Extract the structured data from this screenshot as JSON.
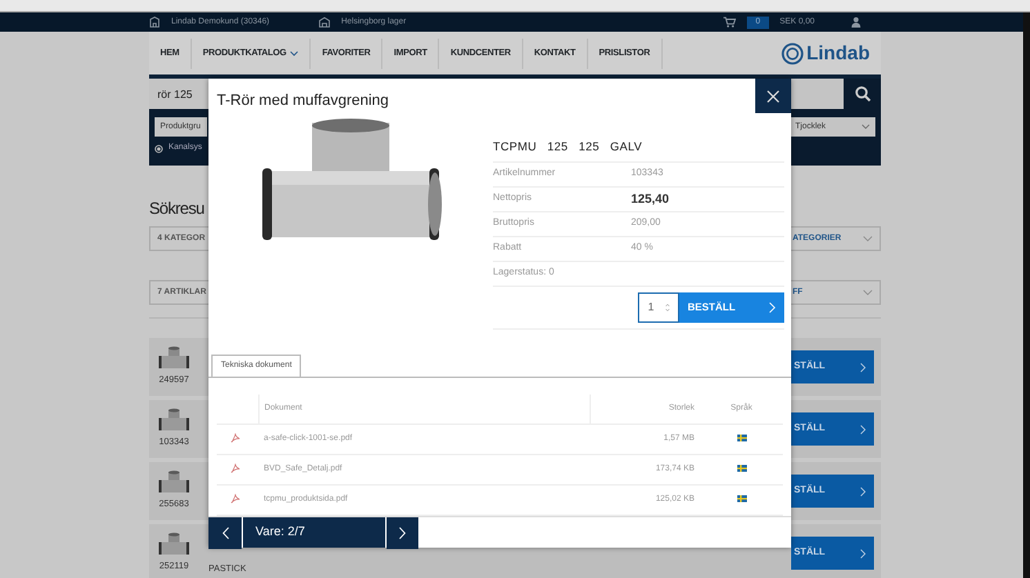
{
  "topbar": {
    "customer": "Lindab Demokund (30346)",
    "warehouse": "Helsingborg lager",
    "cart_count": "0",
    "cart_total": "SEK 0,00"
  },
  "nav": {
    "items": [
      {
        "label": "HEM",
        "dropdown": false
      },
      {
        "label": "PRODUKTKATALOG",
        "dropdown": true
      },
      {
        "label": "FAVORITER",
        "dropdown": false
      },
      {
        "label": "IMPORT",
        "dropdown": false
      },
      {
        "label": "KUNDCENTER",
        "dropdown": false
      },
      {
        "label": "KONTAKT",
        "dropdown": false
      },
      {
        "label": "PRISLISTOR",
        "dropdown": false
      }
    ],
    "logo": "Lindab"
  },
  "search": {
    "value": "rör 125"
  },
  "filters": [
    {
      "label": "Produktgru"
    },
    {
      "label": "Tjocklek"
    }
  ],
  "radio": {
    "label": "Kanalsys",
    "checked": true
  },
  "results": {
    "title": "Sökresu",
    "categories_left": "4 KATEGOR",
    "categories_right": "ATEGORIER",
    "articles_left": "7 ARTIKLAR",
    "articles_right": "FF",
    "rows": [
      {
        "number": "249597",
        "button": "STÄLL"
      },
      {
        "number": "103343",
        "button": "STÄLL"
      },
      {
        "number": "255683",
        "button": "STÄLL"
      },
      {
        "number": "252119",
        "name": "PASTICK",
        "button": "STÄLL"
      }
    ]
  },
  "modal": {
    "title": "T-Rör med muffavgrening",
    "code": "TCPMU 125 125 GALV",
    "specs": [
      {
        "label": "Artikelnummer",
        "value": "103343",
        "emphasis": false
      },
      {
        "label": "Nettopris",
        "value": "125,40",
        "emphasis": true
      },
      {
        "label": "Bruttopris",
        "value": "209,00",
        "emphasis": false
      },
      {
        "label": "Rabatt",
        "value": "40 %",
        "emphasis": false
      }
    ],
    "stock": "Lagerstatus: 0",
    "quantity": "1",
    "order_button": "BESTÄLL",
    "tabs": [
      {
        "label": "Tekniska dokument",
        "selected": true
      }
    ],
    "columns": [
      "Dokument",
      "Storlek",
      "Språk"
    ],
    "documents": [
      {
        "name": "a-safe-click-1001-se.pdf",
        "size": "1,57 MB"
      },
      {
        "name": "BVD_Safe_Detalj.pdf",
        "size": "173,74 KB"
      },
      {
        "name": "tcpmu_produktsida.pdf",
        "size": "125,02 KB"
      }
    ],
    "counter": "Vare: 2/7"
  }
}
